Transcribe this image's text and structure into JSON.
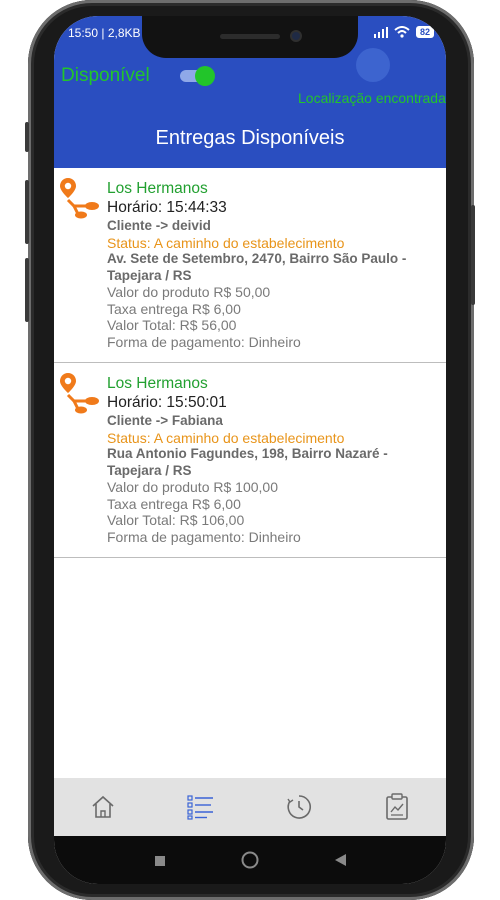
{
  "status_bar": {
    "time": "15:50 | 2,8KB",
    "battery": "82"
  },
  "header": {
    "availability_label": "Disponível",
    "availability_on": true,
    "location_status": "Localização encontrada",
    "title": "Entregas Disponíveis"
  },
  "deliveries": [
    {
      "store": "Los Hermanos",
      "time": "Horário: 15:44:33",
      "client": "Cliente -> deivid",
      "status": "Status: A caminho do estabelecimento",
      "address": "Av. Sete de Setembro, 2470, Bairro São Paulo - Tapejara / RS",
      "product_value": "Valor do produto R$ 50,00",
      "delivery_fee": "Taxa entrega R$ 6,00",
      "total_value": "Valor Total: R$ 56,00",
      "payment_method": "Forma de pagamento: Dinheiro"
    },
    {
      "store": "Los Hermanos",
      "time": "Horário: 15:50:01",
      "client": "Cliente -> Fabiana",
      "status": "Status: A caminho do estabelecimento",
      "address": "Rua Antonio Fagundes, 198, Bairro Nazaré - Tapejara / RS",
      "product_value": "Valor do produto R$ 100,00",
      "delivery_fee": "Taxa entrega R$ 6,00",
      "total_value": "Valor Total: R$ 106,00",
      "payment_method": "Forma de pagamento: Dinheiro"
    }
  ],
  "bottom_nav": {
    "items": [
      "home-icon",
      "list-checklist-icon",
      "history-clock-icon",
      "report-clipboard-icon"
    ],
    "active": "list-checklist-icon"
  },
  "colors": {
    "header": "#2a4ec0",
    "available_green": "#22c52a",
    "store_green": "#22a030",
    "status_orange": "#e8941a",
    "icon_orange": "#f07a1a"
  }
}
